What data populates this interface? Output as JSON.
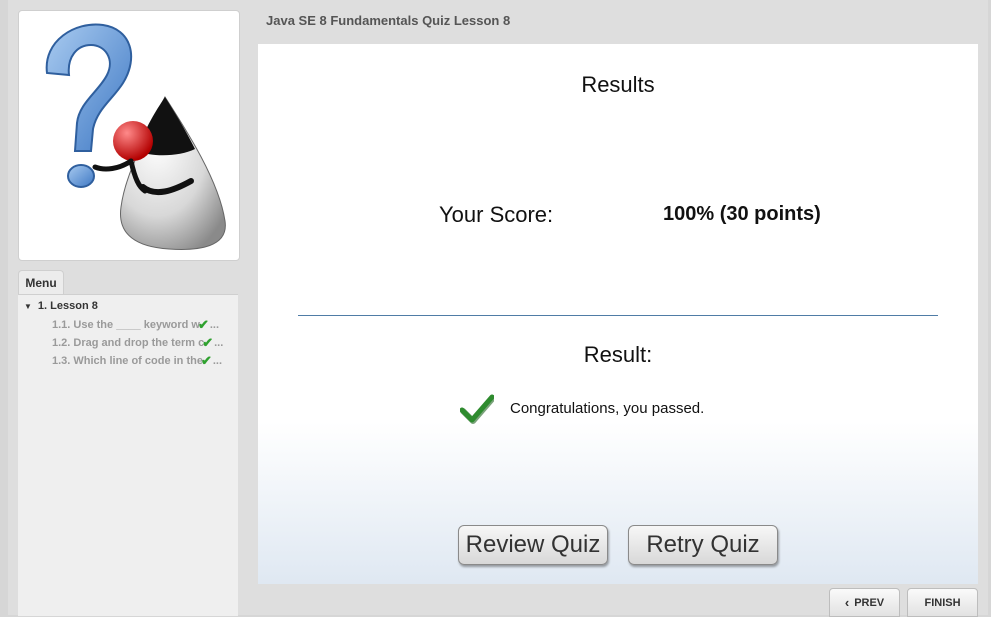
{
  "header": {
    "course_title": "Java SE 8 Fundamentals Quiz Lesson 8"
  },
  "sidebar": {
    "menu_tab_label": "Menu",
    "lesson_label": "1. Lesson 8",
    "items": [
      {
        "label": "1.1. Use the ____ keyword w",
        "status": "complete",
        "ellipsis": "..."
      },
      {
        "label": "1.2. Drag and drop the term c",
        "status": "complete",
        "ellipsis": "..."
      },
      {
        "label": "1.3. Which line of code in the",
        "status": "complete",
        "ellipsis": "..."
      }
    ]
  },
  "results": {
    "title": "Results",
    "score_label": "Your Score:",
    "score_value": "100% (30 points)",
    "result_label": "Result:",
    "message": "Congratulations, you passed.",
    "review_button": "Review Quiz",
    "retry_button": "Retry Quiz"
  },
  "nav": {
    "prev_label": "PREV",
    "finish_label": "FINISH"
  },
  "icons": {
    "logo": "question-mark-mascot-icon",
    "result": "green-check-icon",
    "menu_expand": "triangle-down-icon",
    "prev": "chevron-left-icon"
  },
  "colors": {
    "check_green": "#2e8b2e",
    "menu_check": "#2fa12f",
    "divider": "#4f7ca6"
  }
}
